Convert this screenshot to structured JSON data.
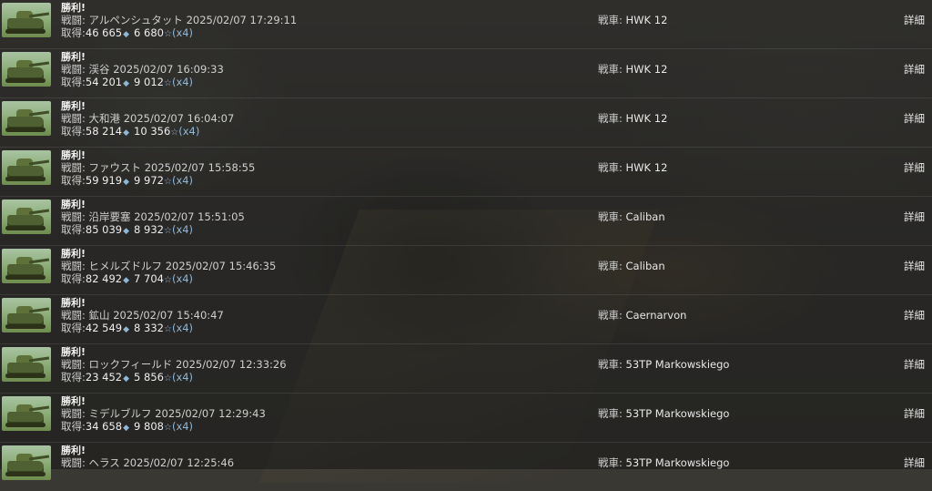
{
  "labels": {
    "battle_prefix": "戦闘:",
    "earned_prefix": "取得:",
    "tank_prefix": "戦車:",
    "detail": "詳細",
    "multiplier": "(x4)"
  },
  "icons": {
    "thumbnail": "tank-thumbnail-icon",
    "credit": "credit-icon",
    "xp": "xp-star-icon"
  },
  "colors": {
    "accent": "#8fb7d6",
    "text": "#cfcfcf",
    "title": "#f2f2f2"
  },
  "battles": [
    {
      "result": "勝利!",
      "map": "アルペンシュタット",
      "datetime": "2025/02/07 17:29:11",
      "credits": "46 665",
      "xp": "6 680",
      "tank": "HWK 12"
    },
    {
      "result": "勝利!",
      "map": "渓谷",
      "datetime": "2025/02/07 16:09:33",
      "credits": "54 201",
      "xp": "9 012",
      "tank": "HWK 12"
    },
    {
      "result": "勝利!",
      "map": "大和港",
      "datetime": "2025/02/07 16:04:07",
      "credits": "58 214",
      "xp": "10 356",
      "tank": "HWK 12"
    },
    {
      "result": "勝利!",
      "map": "ファウスト",
      "datetime": "2025/02/07 15:58:55",
      "credits": "59 919",
      "xp": "9 972",
      "tank": "HWK 12"
    },
    {
      "result": "勝利!",
      "map": "沿岸要塞",
      "datetime": "2025/02/07 15:51:05",
      "credits": "85 039",
      "xp": "8 932",
      "tank": "Caliban"
    },
    {
      "result": "勝利!",
      "map": "ヒメルズドルフ",
      "datetime": "2025/02/07 15:46:35",
      "credits": "82 492",
      "xp": "7 704",
      "tank": "Caliban"
    },
    {
      "result": "勝利!",
      "map": "鉱山",
      "datetime": "2025/02/07 15:40:47",
      "credits": "42 549",
      "xp": "8 332",
      "tank": "Caernarvon"
    },
    {
      "result": "勝利!",
      "map": "ロックフィールド",
      "datetime": "2025/02/07 12:33:26",
      "credits": "23 452",
      "xp": "5 856",
      "tank": "53TP Markowskiego"
    },
    {
      "result": "勝利!",
      "map": "ミデルブルフ",
      "datetime": "2025/02/07 12:29:43",
      "credits": "34 658",
      "xp": "9 808",
      "tank": "53TP Markowskiego"
    },
    {
      "result": "勝利!",
      "map": "ヘラス",
      "datetime": "2025/02/07 12:25:46",
      "credits": "",
      "xp": "",
      "tank": "53TP Markowskiego"
    }
  ]
}
